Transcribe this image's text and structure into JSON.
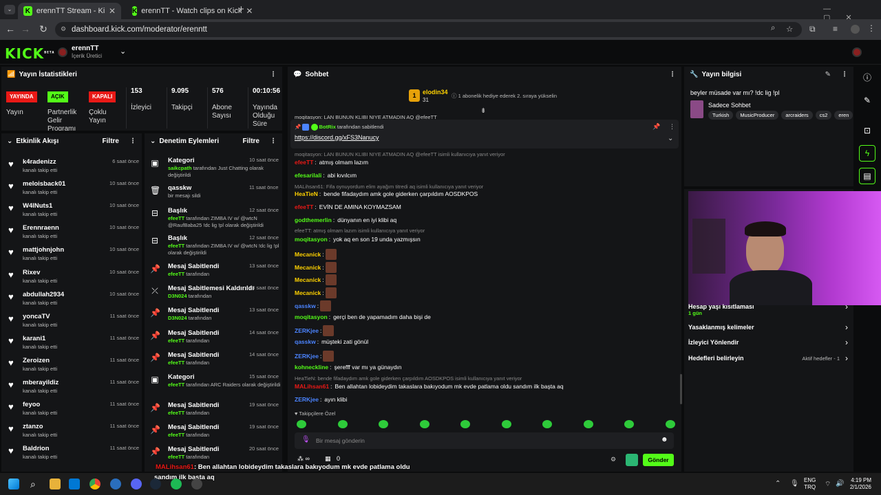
{
  "browser": {
    "tabs": [
      {
        "title": "erennTT Stream - Kick Dashboar",
        "active": true
      },
      {
        "title": "erennTT - Watch clips on Kick",
        "active": false
      }
    ],
    "new_tab": "+",
    "url": "dashboard.kick.com/moderator/erenntt"
  },
  "header": {
    "logo": "KICK",
    "logo_sup": "BETA",
    "channel_name": "erennTT",
    "channel_role": "İçerik Üretici"
  },
  "stats": {
    "title": "Yayın İstatistikleri",
    "badges": [
      {
        "badge": "YAYINDA",
        "label": "Yayın",
        "color": "#e91916"
      },
      {
        "badge": "AÇIK",
        "label": "Partnerlik Gelir Programı",
        "color": "#53fc18"
      },
      {
        "badge": "KAPALI",
        "label": "Çoklu Yayın",
        "color": "#e91916"
      }
    ],
    "numbers": [
      {
        "value": "153",
        "label": "İzleyici"
      },
      {
        "value": "9.095",
        "label": "Takipçi"
      },
      {
        "value": "576",
        "label": "Abone Sayısı"
      },
      {
        "value": "00:10:56",
        "label": "Yayında Olduğu Süre"
      }
    ]
  },
  "activity": {
    "title": "Etkinlik Akışı",
    "filter": "Filtre",
    "items": [
      {
        "name": "k4radenizz",
        "action": "kanalı takip etti",
        "time": "6 saat önce"
      },
      {
        "name": "meloisback01",
        "action": "kanalı takip etti",
        "time": "10 saat önce"
      },
      {
        "name": "W4lNuts1",
        "action": "kanalı takip etti",
        "time": "10 saat önce"
      },
      {
        "name": "Erennraenn",
        "action": "kanalı takip etti",
        "time": "10 saat önce"
      },
      {
        "name": "mattjohnjohn",
        "action": "kanalı takip etti",
        "time": "10 saat önce"
      },
      {
        "name": "Rixev",
        "action": "kanalı takip etti",
        "time": "10 saat önce"
      },
      {
        "name": "abdullah2934",
        "action": "kanalı takip etti",
        "time": "10 saat önce"
      },
      {
        "name": "yoncaTV",
        "action": "kanalı takip etti",
        "time": "11 saat önce"
      },
      {
        "name": "karani1",
        "action": "kanalı takip etti",
        "time": "11 saat önce"
      },
      {
        "name": "Zeroizen",
        "action": "kanalı takip etti",
        "time": "11 saat önce"
      },
      {
        "name": "mberayildiz",
        "action": "kanalı takip etti",
        "time": "11 saat önce"
      },
      {
        "name": "feyoo",
        "action": "kanalı takip etti",
        "time": "11 saat önce"
      },
      {
        "name": "ztanzo",
        "action": "kanalı takip etti",
        "time": "11 saat önce"
      },
      {
        "name": "Baldrion",
        "action": "kanalı takip etti",
        "time": "11 saat önce"
      }
    ]
  },
  "moderation": {
    "title": "Denetim Eylemleri",
    "filter": "Filtre",
    "items": [
      {
        "icon": "category-icon",
        "title": "Kategori",
        "user": "saikcpath",
        "desc": "tarafından Just Chatting olarak değiştirildi",
        "time": "10 saat önce"
      },
      {
        "icon": "delete-icon",
        "title": "qasskw",
        "user": "",
        "desc": "bir mesajı sildi",
        "time": "11 saat önce"
      },
      {
        "icon": "title-icon",
        "title": "Başlık",
        "user": "efeeTT",
        "desc": "tarafından ZIMBA IV w/ @wtcN @RaufBaba25 !dc lig !pl olarak değiştirildi",
        "time": "12 saat önce"
      },
      {
        "icon": "title-icon",
        "title": "Başlık",
        "user": "efeeTT",
        "desc": "tarafından ZIMBA IV w/ @wtcN !dc lig !pl olarak değiştirildi",
        "time": "12 saat önce"
      },
      {
        "icon": "pin-icon",
        "title": "Mesaj Sabitlendi",
        "user": "efeeTT",
        "desc": "tarafından",
        "time": "13 saat önce"
      },
      {
        "icon": "unpin-icon",
        "title": "Mesaj Sabitlemesi Kaldırıldı",
        "user": "D3N024",
        "desc": "tarafından",
        "time": "13 saat önce"
      },
      {
        "icon": "pin-icon",
        "title": "Mesaj Sabitlendi",
        "user": "D3N024",
        "desc": "tarafından",
        "time": "13 saat önce"
      },
      {
        "icon": "pin-icon",
        "title": "Mesaj Sabitlendi",
        "user": "efeeTT",
        "desc": "tarafından",
        "time": "14 saat önce"
      },
      {
        "icon": "pin-icon",
        "title": "Mesaj Sabitlendi",
        "user": "efeeTT",
        "desc": "tarafından",
        "time": "14 saat önce"
      },
      {
        "icon": "category-icon",
        "title": "Kategori",
        "user": "efeeTT",
        "desc": "tarafından ARC Raiders olarak değiştirildi",
        "time": "15 saat önce"
      },
      {
        "icon": "pin-icon",
        "title": "Mesaj Sabitlendi",
        "user": "efeeTT",
        "desc": "tarafından",
        "time": "19 saat önce"
      },
      {
        "icon": "pin-icon",
        "title": "Mesaj Sabitlendi",
        "user": "efeeTT",
        "desc": "tarafından",
        "time": "19 saat önce"
      },
      {
        "icon": "pin-icon",
        "title": "Mesaj Sabitlendi",
        "user": "efeeTT",
        "desc": "tarafından",
        "time": "20 saat önce"
      }
    ]
  },
  "chat": {
    "title": "Sohbet",
    "gift_user": "elodin34",
    "gift_count": "31",
    "gift_text": "1 abonelik hediye ederek 2. sıraya yükselin",
    "cut_top": "moqitasyon: LAN BUNUN KLIBI NIYE ATMADIN AQ @efeeTT",
    "pinned_by": "BotRix",
    "pinned_suffix": "tarafından sabitlendi",
    "pinned_link": "https://discord.gg/xFS3Nanucy",
    "messages": [
      {
        "reply": "moqitasyon: LAN BUNUN KLIBI NIYE ATMADIN AQ @efeeTT isimli kullanıcıya yanıt veriyor"
      },
      {
        "user": "efeeTT",
        "color": "#e91916",
        "text": "atmış olmam lazım"
      },
      {
        "user": "efesarilali",
        "color": "#53fc18",
        "text": "abi kıvılcım"
      },
      {
        "reply": "MALihsan61: Fifa oynuyordum elim ayağım titredi aq isimli kullanıcıya yanıt veriyor"
      },
      {
        "user": "HeaTieN",
        "color": "#ffd200",
        "text": "bende fifadaydım amk gole giderken çarpıldım AOSDKPOS"
      },
      {
        "user": "efeeTT",
        "color": "#e91916",
        "text": "EVİN DE AMINA KOYMAZSAM"
      },
      {
        "user": "godthemerlin",
        "color": "#53fc18",
        "text": "dünyanın en iyi klibi aq"
      },
      {
        "reply": "efeeTT: atmış olmam lazım isimli kullanıcıya yanıt veriyor"
      },
      {
        "user": "moqitasyon",
        "color": "#53fc18",
        "text": "yok aq en son 19 unda yazmışsın"
      },
      {
        "user": "Mecanick",
        "color": "#ffd200",
        "text": ""
      },
      {
        "user": "Mecanick",
        "color": "#ffd200",
        "text": ""
      },
      {
        "user": "Mecanick",
        "color": "#ffd200",
        "text": ""
      },
      {
        "user": "Mecanick",
        "color": "#ffd200",
        "text": ""
      },
      {
        "user": "qasskw",
        "color": "#4b84ff",
        "text": ""
      },
      {
        "user": "moqitasyon",
        "color": "#53fc18",
        "text": "gerçi ben de yapamadım daha bişi de"
      },
      {
        "user": "ZERKjee",
        "color": "#4b84ff",
        "text": ""
      },
      {
        "user": "qasskw",
        "color": "#4b84ff",
        "text": "müşteki zati gönül"
      },
      {
        "user": "ZERKjee",
        "color": "#4b84ff",
        "text": ""
      },
      {
        "user": "kohneckline",
        "color": "#53fc18",
        "text": "şerefff var mı ya günaydın"
      },
      {
        "reply": "HeaTieN: bende fifadaydım amk gole giderken çarpıldım AOSDKPOS isimli kullanıcıya yanıt veriyor"
      },
      {
        "user": "MALihsan61",
        "color": "#e91916",
        "text": "Ben allahtan lobideydim takaslara bakıyodum mk evde patlama oldu sandım ilk başta aq"
      },
      {
        "user": "ZERKjee",
        "color": "#4b84ff",
        "text": "ayın klibi"
      }
    ],
    "followers_only": "Takipçilere Özel",
    "input_placeholder": "Bir mesaj gönderin",
    "points": "∞",
    "shop_count": "0",
    "send": "Gönder"
  },
  "info": {
    "title": "Yayın bilgisi",
    "stream_title": "beyler müsade var mı? !dc lig !pl",
    "category": "Sadece Sohbet",
    "tags": [
      "Turkish",
      "MusicProducer",
      "arcraiders",
      "cs2",
      "eren"
    ],
    "settings": [
      {
        "label": "Hesap yaşı kısıtlaması",
        "value": "1 gün"
      },
      {
        "label": "Yasaklanmış kelimeler",
        "value": ""
      },
      {
        "label": "İzleyici Yönlendir",
        "value": ""
      },
      {
        "label": "Hedefleri belirleyin",
        "value": "Aktif hedefler - 1"
      }
    ]
  },
  "overlay_chat": {
    "user": "MALihsan61",
    "text": ": Ben allahtan lobideydim takaslara bakıyodum mk evde patlama oldu",
    "text2": "sandım ilk başta aq"
  },
  "taskbar": {
    "lang": "ENG",
    "lang2": "TRQ",
    "time": "4:19 PM",
    "date": "2/1/2026"
  }
}
